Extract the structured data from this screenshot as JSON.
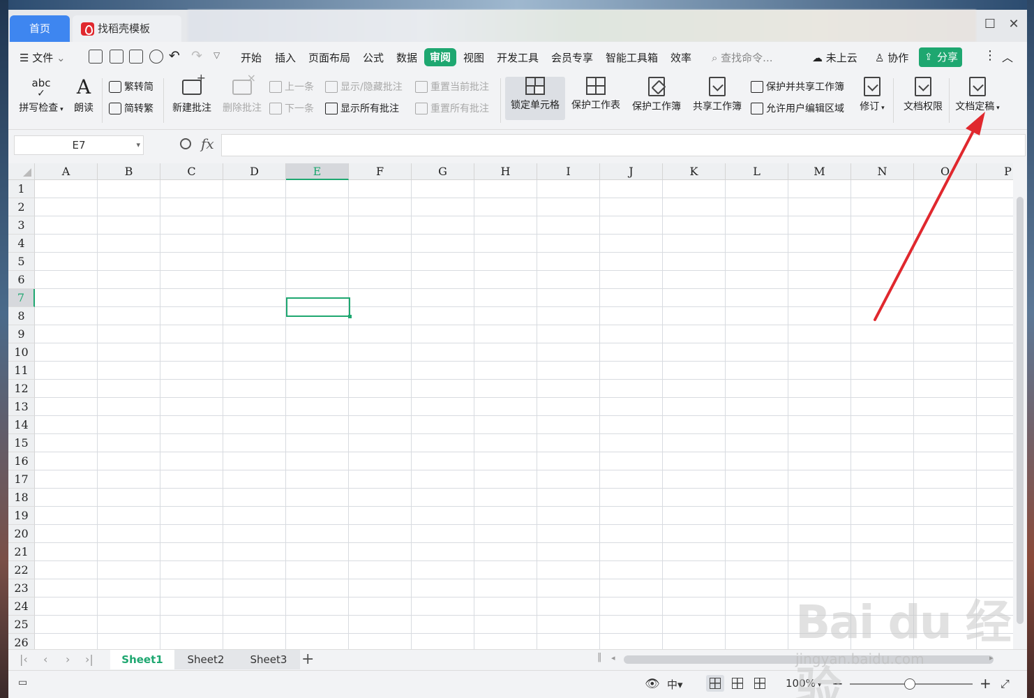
{
  "titlebar": {
    "tabs": [
      {
        "label": "首页"
      },
      {
        "label": "找稻壳模板"
      }
    ],
    "maximize_icon": "maximize-icon",
    "close_icon": "close-icon"
  },
  "menubar": {
    "file_label": "文件",
    "items": [
      "开始",
      "插入",
      "页面布局",
      "公式",
      "数据",
      "审阅",
      "视图",
      "开发工具",
      "会员专享",
      "智能工具箱",
      "效率"
    ],
    "active_item": "审阅",
    "search_placeholder": "查找命令...",
    "cloud_label": "未上云",
    "collab_label": "协作",
    "share_label": "分享"
  },
  "ribbon": {
    "spellcheck": "拼写检查",
    "spellcheck_icon_text": "abc",
    "read_aloud": "朗读",
    "trad_simp": "繁转简",
    "simp_trad": "简转繁",
    "new_comment": "新建批注",
    "delete_comment": "删除批注",
    "prev": "上一条",
    "next": "下一条",
    "show_hide_comment": "显示/隐藏批注",
    "show_all_comments": "显示所有批注",
    "reset_current_comment": "重置当前批注",
    "reset_all_comments": "重置所有批注",
    "lock_cell": "锁定单元格",
    "protect_sheet": "保护工作表",
    "protect_workbook": "保护工作簿",
    "share_workbook": "共享工作簿",
    "protect_share_workbook": "保护并共享工作簿",
    "allow_edit_ranges": "允许用户编辑区域",
    "revise": "修订",
    "doc_permission": "文档权限",
    "doc_finalize": "文档定稿"
  },
  "formula_bar": {
    "cell_ref": "E7",
    "fx_label": "fx",
    "formula_value": ""
  },
  "grid": {
    "columns": [
      "A",
      "B",
      "C",
      "D",
      "E",
      "F",
      "G",
      "H",
      "I",
      "J",
      "K",
      "L",
      "M",
      "N",
      "O",
      "P"
    ],
    "rows": [
      "1",
      "2",
      "3",
      "4",
      "5",
      "6",
      "7",
      "8",
      "9",
      "10",
      "11",
      "12",
      "13",
      "14",
      "15",
      "16",
      "17",
      "18",
      "19",
      "20",
      "21",
      "22",
      "23",
      "24",
      "25",
      "26"
    ],
    "selected_column": "E",
    "selected_row": "7"
  },
  "sheets": {
    "tabs": [
      "Sheet1",
      "Sheet2",
      "Sheet3"
    ],
    "active": "Sheet1"
  },
  "statusbar": {
    "zoom": "100%"
  },
  "watermark": {
    "text": "Bai du 经验",
    "url": "jingyan.baidu.com"
  },
  "colors": {
    "accent_green": "#1ea770",
    "home_tab_blue": "#3e86f0",
    "annotation_arrow": "#e0282e"
  }
}
